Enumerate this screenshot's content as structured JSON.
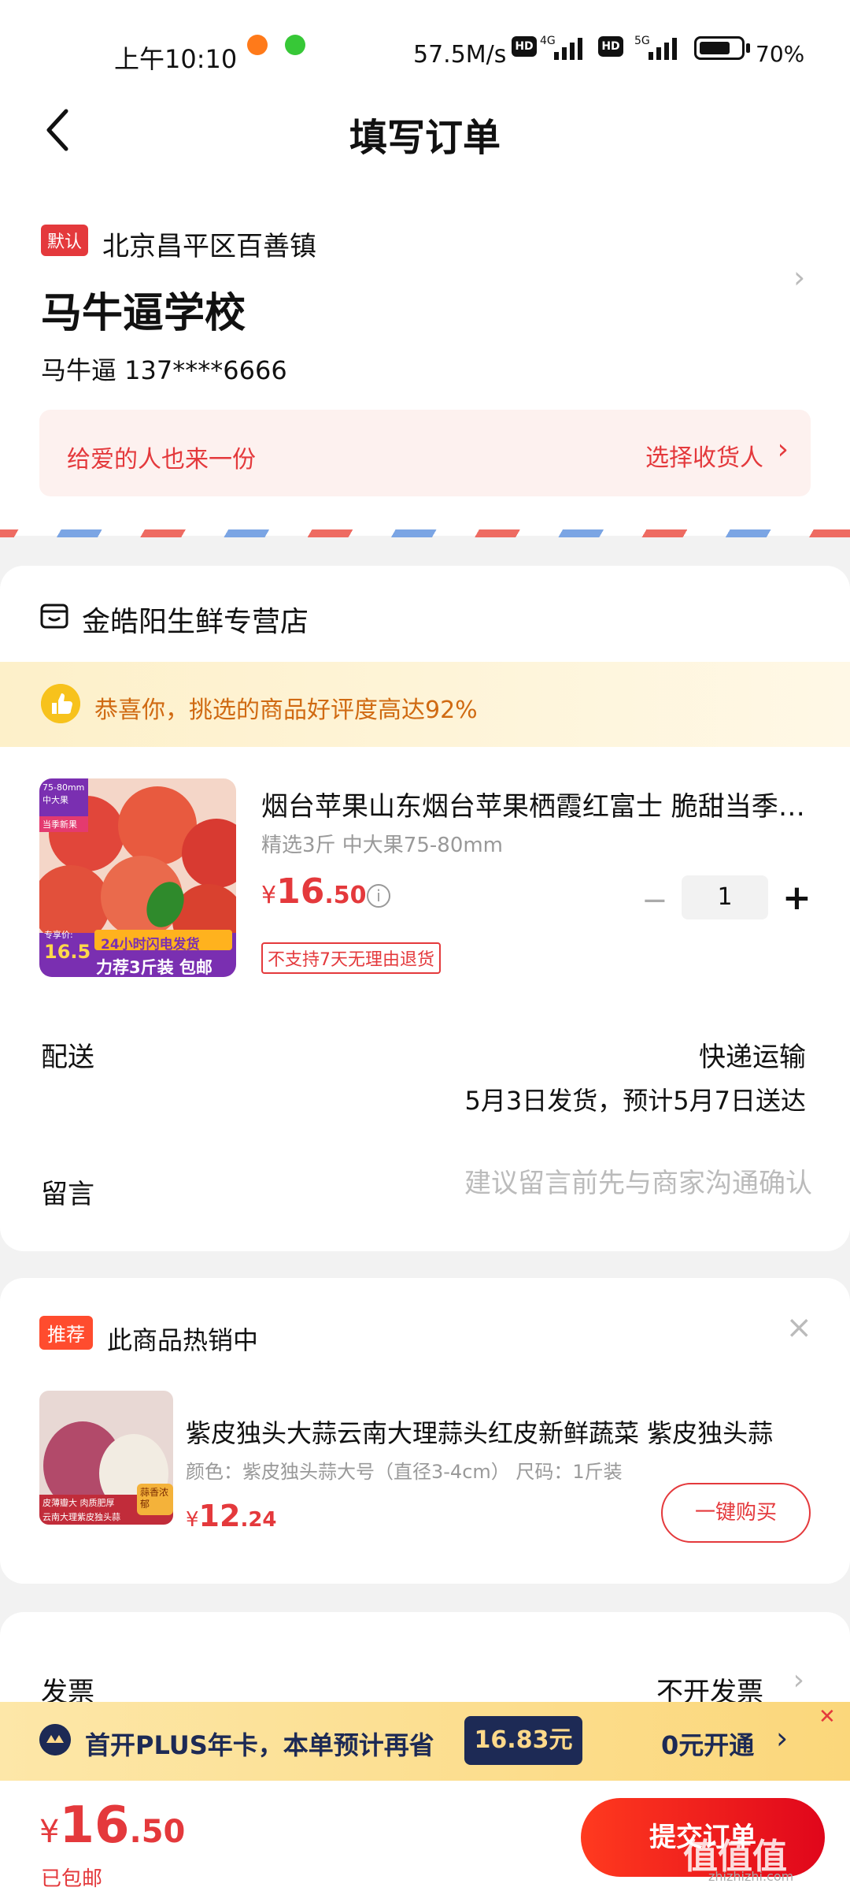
{
  "status_bar": {
    "time": "上午10:10",
    "speed": "57.5M/s",
    "hd1": "HD",
    "net1": "4G",
    "hd2": "HD",
    "net2": "5G",
    "battery": "70%"
  },
  "header": {
    "title": "填写订单",
    "back_icon": "chevron-left-icon"
  },
  "address": {
    "default_tag": "默认",
    "region": "北京昌平区百善镇",
    "name": "马牛逼学校",
    "person": "马牛逼  137****6666",
    "gift_tip": "给爱的人也来一份",
    "gift_action": "选择收货人"
  },
  "shop": {
    "name": "金皓阳生鲜专营店",
    "praise": "恭喜你，挑选的商品好评度高达92%",
    "product": {
      "title": "烟台苹果山东烟台苹果栖霞红富士 脆甜当季新鲜水果",
      "spec": "精选3斤 中大果75-80mm",
      "price_currency": "¥",
      "price_int": "16",
      "price_dec": ".50",
      "quantity": "1",
      "no_return": "不支持7天无理由退货",
      "img_badge_top": "75-80mm\n中大果",
      "img_badge_season": "当季新果",
      "img_price_label": "专享价:",
      "img_price": "16.5",
      "img_flash": "24小时闪电发货",
      "img_promo": "力荐3斤装 包邮"
    },
    "shipping_label": "配送",
    "shipping_value": "快递运输",
    "shipping_date": "5月3日发货，预计5月7日送达",
    "note_label": "留言",
    "note_placeholder": "建议留言前先与商家沟通确认"
  },
  "recommend": {
    "tag": "推荐",
    "title": "此商品热销中",
    "name": "紫皮独头大蒜云南大理蒜头红皮新鲜蔬菜 紫皮独头蒜",
    "spec": "颜色：紫皮独头蒜大号（直径3-4cm）    尺码：1斤装",
    "price_currency": "¥",
    "price_int": "12",
    "price_dec": ".24",
    "buy_label": "一键购买",
    "img_label1": "皮薄瓣大 肉质肥厚",
    "img_label2": "云南大理紫皮独头蒜",
    "img_label3": "蒜香浓郁"
  },
  "invoice": {
    "label": "发票",
    "value": "不开发票"
  },
  "plus_banner": {
    "text": "首开PLUS年卡，本单预计再省",
    "save_amount": "16.83元",
    "open_label": "0元开通"
  },
  "bottom": {
    "currency": "¥",
    "total_int": "16",
    "total_dec": ".50",
    "free_shipping": "已包邮",
    "submit_label": "提交订单",
    "watermark": "值值值",
    "watermark_sub": "zhizhizhi.com"
  },
  "colors": {
    "accent": "#e4393c",
    "plus_navy": "#1d2a55",
    "praise_text": "#d06a12"
  }
}
